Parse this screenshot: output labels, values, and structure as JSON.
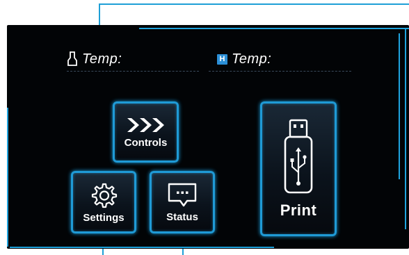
{
  "screen": {
    "temp_labels": {
      "nozzle": "Temp:",
      "bed_badge": "H",
      "bed": "Temp:"
    },
    "buttons": {
      "controls": "Controls",
      "settings": "Settings",
      "status": "Status",
      "print": "Print"
    },
    "icons": {
      "nozzle": "nozzle-icon",
      "bed": "heated-bed-icon",
      "controls": "triple-chevron-right-icon",
      "settings": "gear-icon",
      "status": "speech-bubble-ellipsis-icon",
      "print": "usb-drive-icon"
    },
    "colors": {
      "background": "#020406",
      "accent": "#1f9ad6",
      "text": "#ffffff",
      "badge": "#2b8fd6"
    }
  }
}
